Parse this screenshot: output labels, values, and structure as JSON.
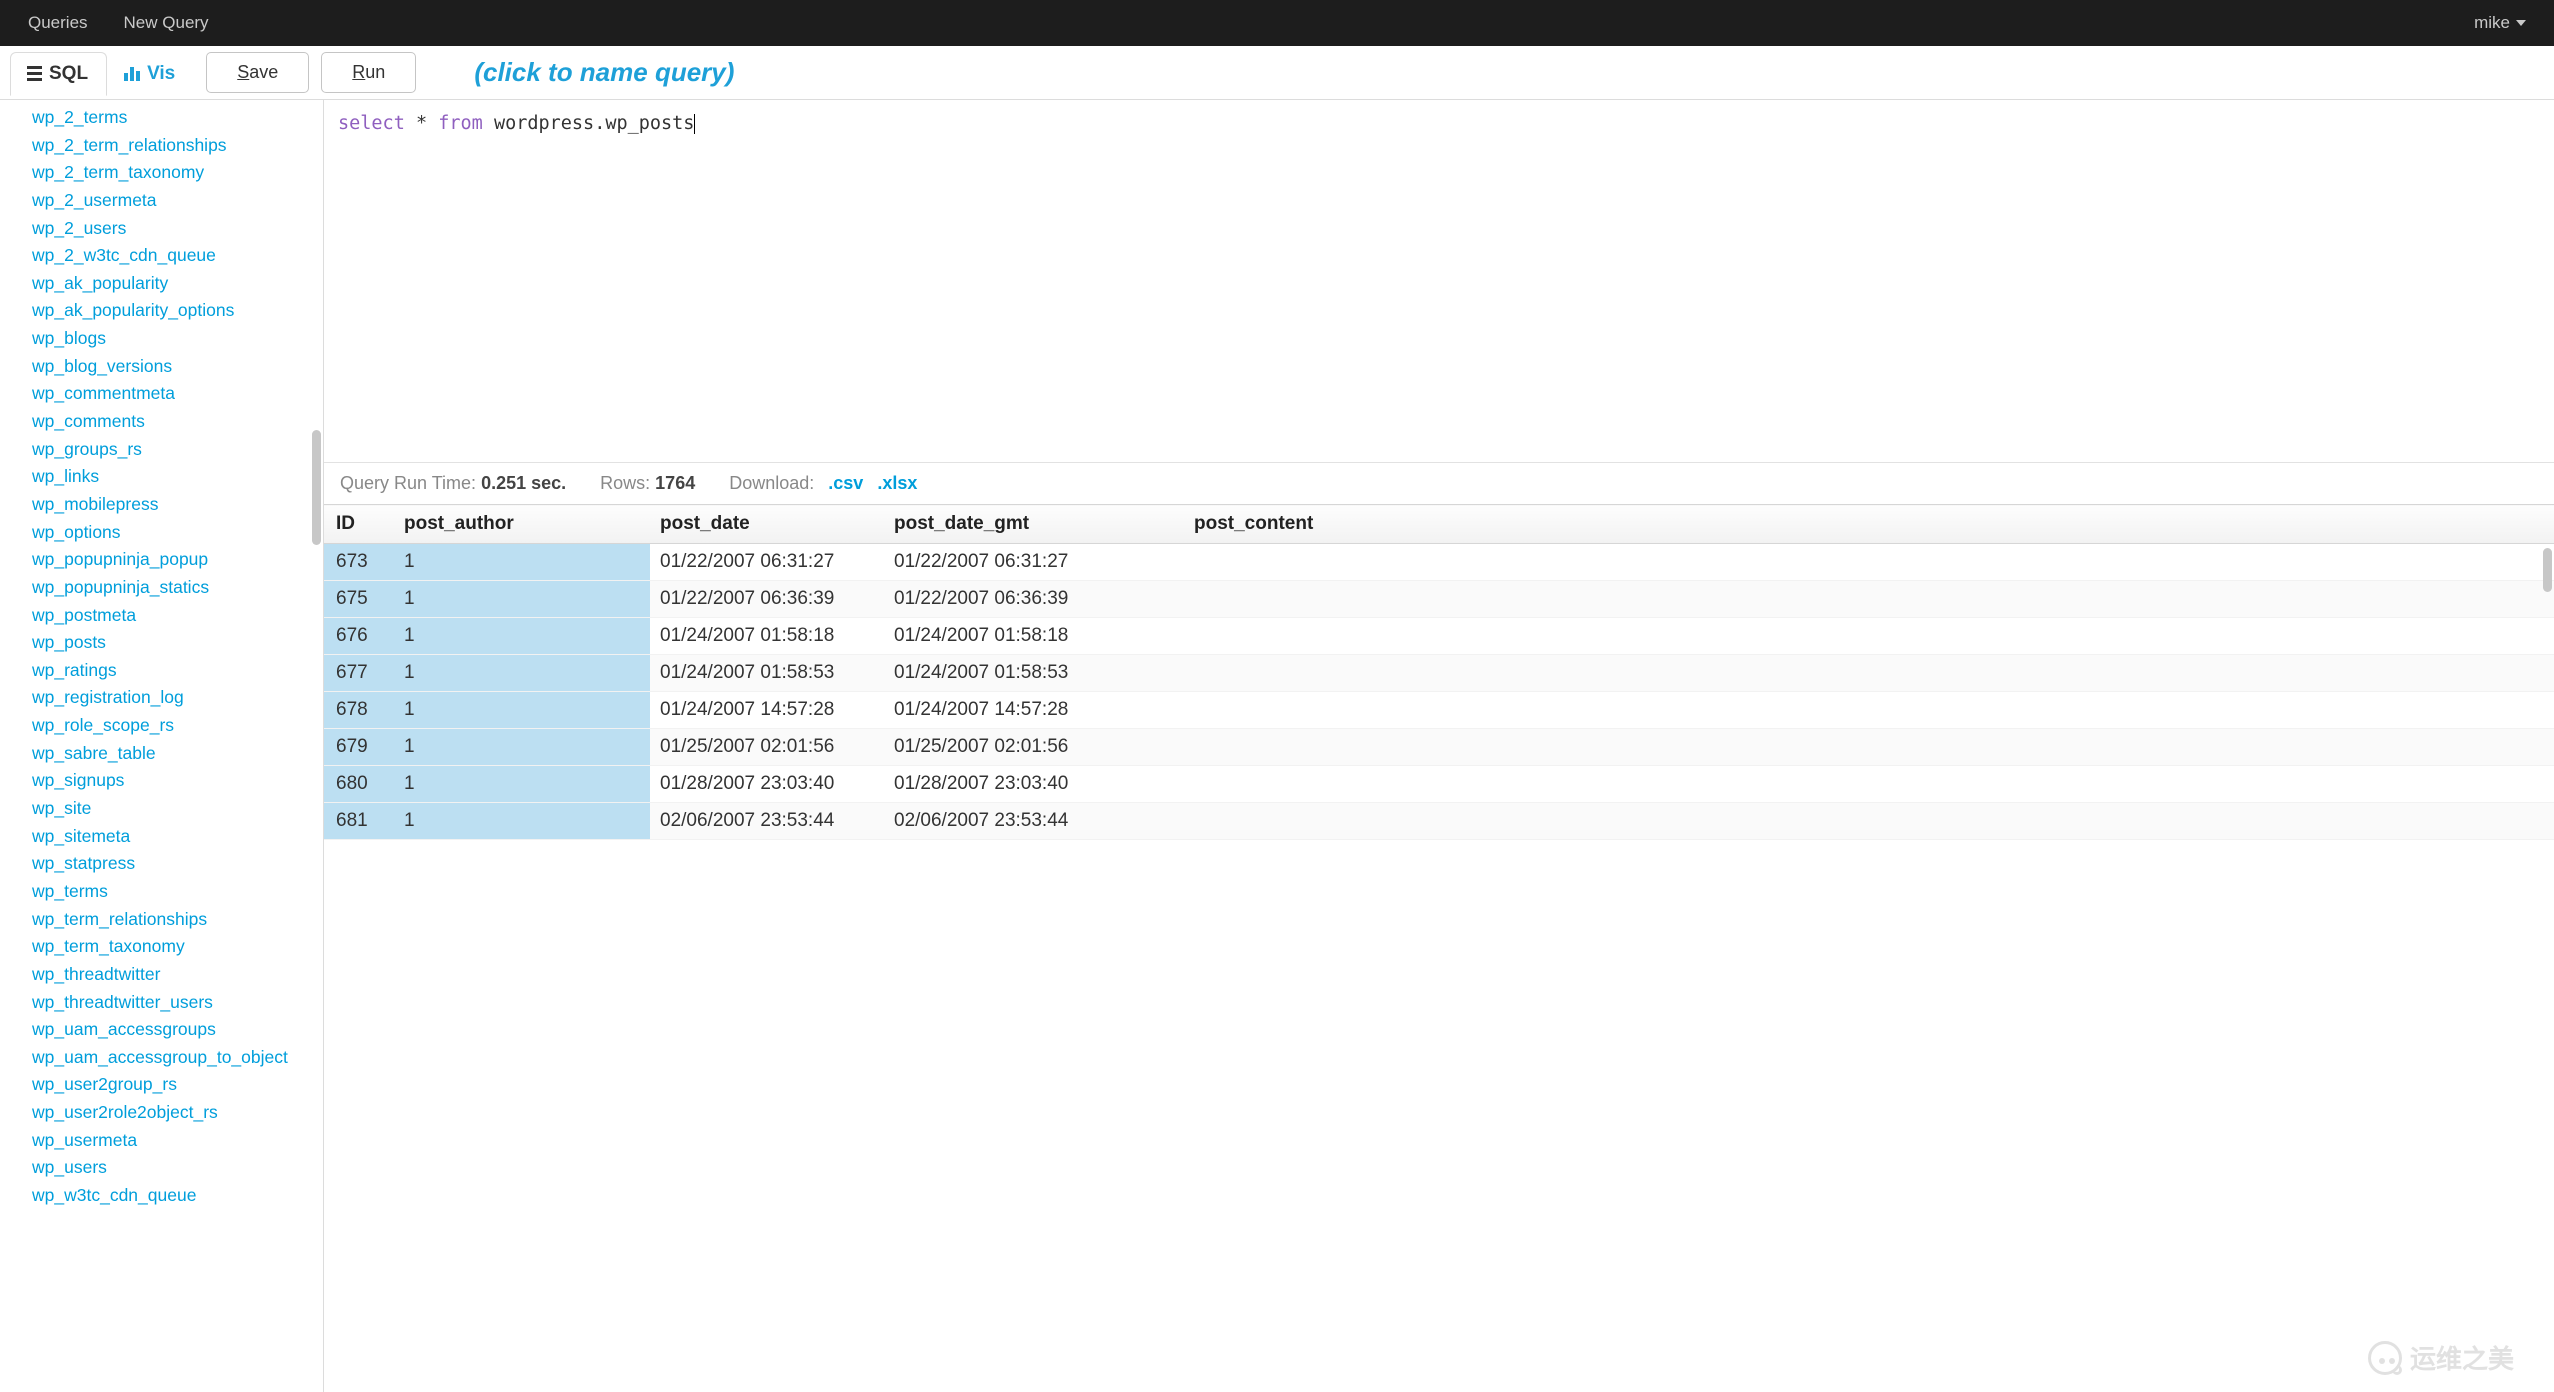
{
  "nav": {
    "links": [
      "Queries",
      "New Query"
    ],
    "user": "mike"
  },
  "toolbar": {
    "tab_sql": "SQL",
    "tab_vis": "Vis",
    "save_label": "Save",
    "save_accel": "S",
    "run_label": "Run",
    "run_accel": "R"
  },
  "query_name_placeholder": "(click to name query)",
  "editor": {
    "kw_select": "select",
    "star": "*",
    "kw_from": "from",
    "ident": "wordpress.wp_posts"
  },
  "tables": [
    "wp_2_terms",
    "wp_2_term_relationships",
    "wp_2_term_taxonomy",
    "wp_2_usermeta",
    "wp_2_users",
    "wp_2_w3tc_cdn_queue",
    "wp_ak_popularity",
    "wp_ak_popularity_options",
    "wp_blogs",
    "wp_blog_versions",
    "wp_commentmeta",
    "wp_comments",
    "wp_groups_rs",
    "wp_links",
    "wp_mobilepress",
    "wp_options",
    "wp_popupninja_popup",
    "wp_popupninja_statics",
    "wp_postmeta",
    "wp_posts",
    "wp_ratings",
    "wp_registration_log",
    "wp_role_scope_rs",
    "wp_sabre_table",
    "wp_signups",
    "wp_site",
    "wp_sitemeta",
    "wp_statpress",
    "wp_terms",
    "wp_term_relationships",
    "wp_term_taxonomy",
    "wp_threadtwitter",
    "wp_threadtwitter_users",
    "wp_uam_accessgroups",
    "wp_uam_accessgroup_to_object",
    "wp_user2group_rs",
    "wp_user2role2object_rs",
    "wp_usermeta",
    "wp_users",
    "wp_w3tc_cdn_queue"
  ],
  "status": {
    "runtime_label": "Query Run Time:",
    "runtime_value": "0.251 sec.",
    "rows_label": "Rows:",
    "rows_value": "1764",
    "download_label": "Download:",
    "csv": ".csv",
    "xlsx": ".xlsx"
  },
  "results": {
    "columns": [
      "ID",
      "post_author",
      "post_date",
      "post_date_gmt",
      "post_content"
    ],
    "rows": [
      {
        "id": "673",
        "author": "1",
        "date": "01/22/2007 06:31:27",
        "gmt": "01/22/2007 06:31:27",
        "content": ""
      },
      {
        "id": "675",
        "author": "1",
        "date": "01/22/2007 06:36:39",
        "gmt": "01/22/2007 06:36:39",
        "content": ""
      },
      {
        "id": "676",
        "author": "1",
        "date": "01/24/2007 01:58:18",
        "gmt": "01/24/2007 01:58:18",
        "content": ""
      },
      {
        "id": "677",
        "author": "1",
        "date": "01/24/2007 01:58:53",
        "gmt": "01/24/2007 01:58:53",
        "content": ""
      },
      {
        "id": "678",
        "author": "1",
        "date": "01/24/2007 14:57:28",
        "gmt": "01/24/2007 14:57:28",
        "content": ""
      },
      {
        "id": "679",
        "author": "1",
        "date": "01/25/2007 02:01:56",
        "gmt": "01/25/2007 02:01:56",
        "content": ""
      },
      {
        "id": "680",
        "author": "1",
        "date": "01/28/2007 23:03:40",
        "gmt": "01/28/2007 23:03:40",
        "content": ""
      },
      {
        "id": "681",
        "author": "1",
        "date": "02/06/2007 23:53:44",
        "gmt": "02/06/2007 23:53:44",
        "content": ""
      }
    ]
  },
  "watermark": "运维之美"
}
